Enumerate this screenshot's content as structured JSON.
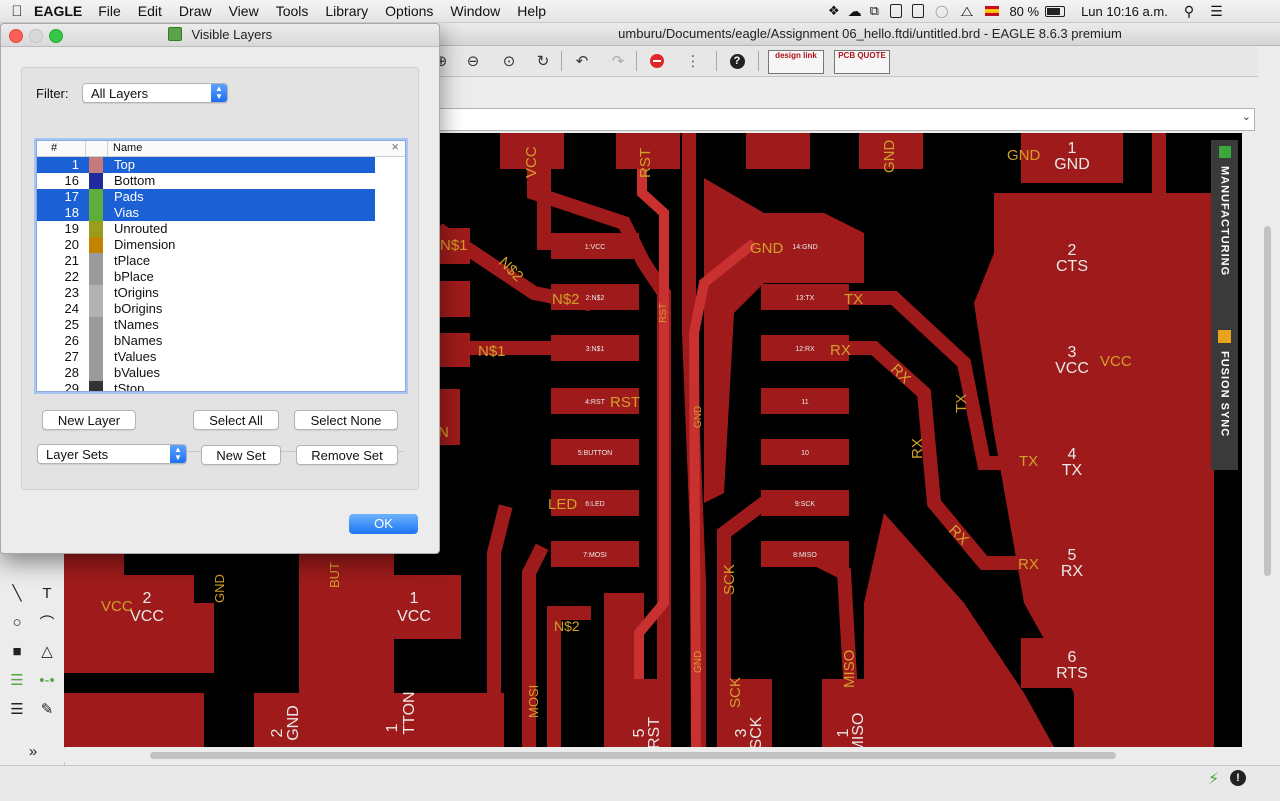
{
  "menubar": {
    "app": "EAGLE",
    "items": [
      "File",
      "Edit",
      "Draw",
      "View",
      "Tools",
      "Library",
      "Options",
      "Window",
      "Help"
    ],
    "battery": "80 %",
    "clock": "Lun 10:16 a.m."
  },
  "window": {
    "title": "umburu/Documents/eagle/Assignment 06_hello.ftdi/untitled.brd - EAGLE 8.6.3 premium"
  },
  "toolbar": {
    "design_link": "design link",
    "pcb_quote": "PCB QUOTE"
  },
  "side_tabs": {
    "manufacturing": "MANUFACTURING",
    "fusion_sync": "FUSION SYNC"
  },
  "dialog": {
    "title": "Visible Layers",
    "filter_label": "Filter:",
    "filter_value": "All Layers",
    "col_num": "#",
    "col_name": "Name",
    "layers": [
      {
        "num": "1",
        "name": "Top",
        "color": "#c47a7a",
        "selected": true
      },
      {
        "num": "16",
        "name": "Bottom",
        "color": "#1f2a9c",
        "selected": false
      },
      {
        "num": "17",
        "name": "Pads",
        "color": "#5fae3c",
        "selected": true
      },
      {
        "num": "18",
        "name": "Vias",
        "color": "#5fae3c",
        "selected": true
      },
      {
        "num": "19",
        "name": "Unrouted",
        "color": "#9a9d1a",
        "selected": false
      },
      {
        "num": "20",
        "name": "Dimension",
        "color": "#c28300",
        "selected": false
      },
      {
        "num": "21",
        "name": "tPlace",
        "color": "#9a9a9a",
        "selected": false
      },
      {
        "num": "22",
        "name": "bPlace",
        "color": "#9a9a9a",
        "selected": false
      },
      {
        "num": "23",
        "name": "tOrigins",
        "color": "#b3b3b3",
        "selected": false
      },
      {
        "num": "24",
        "name": "bOrigins",
        "color": "#b3b3b3",
        "selected": false
      },
      {
        "num": "25",
        "name": "tNames",
        "color": "#9a9a9a",
        "selected": false
      },
      {
        "num": "26",
        "name": "bNames",
        "color": "#9a9a9a",
        "selected": false
      },
      {
        "num": "27",
        "name": "tValues",
        "color": "#9a9a9a",
        "selected": false
      },
      {
        "num": "28",
        "name": "bValues",
        "color": "#9a9a9a",
        "selected": false
      },
      {
        "num": "29",
        "name": "tStop",
        "color": "#333333",
        "selected": false
      }
    ],
    "new_layer": "New Layer",
    "select_all": "Select All",
    "select_none": "Select None",
    "layer_sets": "Layer Sets",
    "new_set": "New Set",
    "remove_set": "Remove Set",
    "ok": "OK"
  },
  "board": {
    "trace_color": "#9f1b1b",
    "label_color": "#d2a02a",
    "pin_labels": [
      "1:VCC",
      "2:N$2",
      "3:N$1",
      "4:RST",
      "5:BUTTON",
      "6:LED",
      "7:MOSI",
      "14:GND",
      "13:TX",
      "12:RX",
      "11",
      "10",
      "9:SCK",
      "8:MISO"
    ],
    "net_labels": [
      "VCC",
      "N$2",
      "N$1",
      "RST",
      "LED",
      "GND",
      "TX",
      "RX",
      "SCK",
      "MISO",
      "MOSI",
      "N$2",
      "GND",
      "GND",
      "RST",
      "GND",
      "RST",
      "GND",
      "VCC",
      "RX",
      "TX",
      "RX",
      "RX",
      "TX",
      "RX",
      "SCK",
      "BUT",
      "GND",
      "VCC",
      "N$2",
      "N$1",
      "N"
    ],
    "pads": [
      {
        "num": "1",
        "name": "GND"
      },
      {
        "num": "2",
        "name": "CTS"
      },
      {
        "num": "3",
        "name": "VCC"
      },
      {
        "num": "4",
        "name": "TX"
      },
      {
        "num": "5",
        "name": "RX"
      },
      {
        "num": "6",
        "name": "RTS"
      },
      {
        "num": "2",
        "name": "VCC"
      },
      {
        "num": "1",
        "name": "VCC"
      },
      {
        "num": "5",
        "name": "RST"
      },
      {
        "num": "3",
        "name": "SCK"
      },
      {
        "num": "1",
        "name": "MISO"
      },
      {
        "num": "1",
        "name": "TTON"
      },
      {
        "num": "2",
        "name": "GND"
      }
    ]
  }
}
